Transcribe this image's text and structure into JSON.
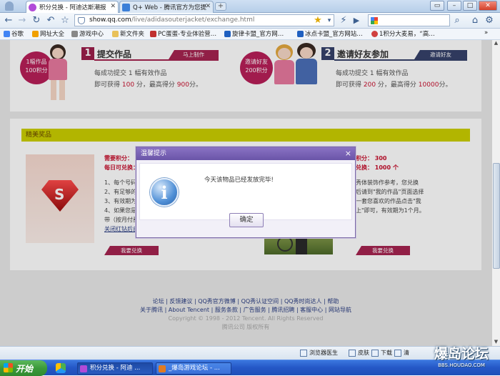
{
  "browser": {
    "tabs": [
      {
        "title": "积分兑换 - 阿迪达斯潮报",
        "active": true
      },
      {
        "title": "Q+ Web - 腾讯官方为您提",
        "active": false
      }
    ],
    "new_tab": "+",
    "url_host": "show.qq.com",
    "url_path": "/live/adidasouterjacket/exchange.html",
    "window_controls": [
      "▭",
      "–",
      "□",
      "✕"
    ]
  },
  "bookmarks": [
    {
      "label": "谷歌",
      "color": "#4285f4"
    },
    {
      "label": "网址大全",
      "color": "#f0a000"
    },
    {
      "label": "游戏中心",
      "color": "#888888"
    },
    {
      "label": "新文件夹",
      "color": "#e8c15a"
    },
    {
      "label": "PC蛋蛋-专业体验营…",
      "color": "#c03030"
    },
    {
      "label": "旋律卡盟_官方网…",
      "color": "#2060c0"
    },
    {
      "label": "冰点卡盟_官方网站…",
      "color": "#2060c0"
    },
    {
      "label": "1积分大麦易，“高…",
      "color": "#d04040"
    }
  ],
  "page": {
    "step1": {
      "badge_line1": "1幅作品",
      "badge_line2": "100积分",
      "num": "1",
      "title": "提交作品",
      "button": "马上制作",
      "line1": "每成功提交 1 幅有效作品",
      "line2_a": "即可获得 ",
      "line2_b": "100",
      "line2_c": " 分，最高得分 ",
      "line2_d": "900",
      "line2_e": "分。"
    },
    "step2": {
      "badge_line1": "邀请好友",
      "badge_line2": "200积分",
      "num": "2",
      "title": "邀请好友参加",
      "button": "邀请好友",
      "line1": "每成功提交 1 幅有效作品",
      "line2_a": "即可获得 ",
      "line2_b": "200",
      "line2_c": " 分，最高得分 ",
      "line2_d": "10000",
      "line2_e": "分。"
    },
    "section_title": "精美奖品",
    "prize_left": {
      "points_label": "需要积分：",
      "daily_label": "每日可兑换：",
      "rules": [
        "1、每个号码",
        "2、有足够的",
        "3、有效期为",
        "4、如果您是",
        "带（按月付费",
        "关闭红钻后自"
      ],
      "button": "我要兑换"
    },
    "prize_right": {
      "points_text": "积分：  300",
      "daily_text": "兑换：  1000 个",
      "rules": [
        "秀体装饰作参考，您兑换",
        "后请到\"我的作品\"页面选择",
        "一套您喜欢的作品点击\"我",
        "上\"即可，有效期为1个月。"
      ],
      "button": "我要兑换"
    },
    "footer_line1": "论坛 | 反馈建议 | QQ秀官方微博 | QQ秀认证空间 | QQ秀时尚达人 | 帮助",
    "footer_line2": "关于腾讯 | About Tencent | 服务条款 | 广告服务 | 腾讯招聘 | 客服中心 | 网站导航",
    "footer_line3": "Copyright © 1998 - 2012 Tencent. All Rights Reserved",
    "footer_line4": "腾讯公司 版权所有"
  },
  "dialog": {
    "title": "温馨提示",
    "close": "×",
    "message": "今天该物品已经发放完毕!",
    "ok": "确定",
    "icon_glyph": "i"
  },
  "statusbar": {
    "items": [
      "浏览器医生",
      "皮肤",
      "下载",
      "清"
    ]
  },
  "taskbar": {
    "start": "开始",
    "windows": [
      {
        "label": "积分兑换 - 阿迪 ...",
        "active": true
      },
      {
        "label": "_爆岛游戏论坛 - ...",
        "active": false
      }
    ]
  },
  "watermark": {
    "main": "爆岛论坛",
    "sub": "BBS.HOUDAO.COM"
  }
}
